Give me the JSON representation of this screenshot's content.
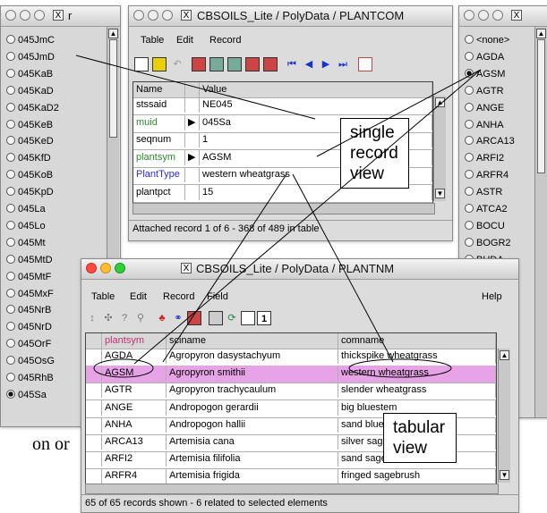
{
  "left_window": {
    "title": "r",
    "items": [
      "045JmC",
      "045JmD",
      "045KaB",
      "045KaD",
      "045KaD2",
      "045KeB",
      "045KeD",
      "045KfD",
      "045KoB",
      "045KpD",
      "045La",
      "045Lo",
      "045Mt",
      "045MtD",
      "045MtF",
      "045MxF",
      "045NrB",
      "045NrD",
      "045OrF",
      "045OsG",
      "045RhB",
      "045Sa"
    ],
    "selected": "045Sa"
  },
  "record_window": {
    "title": "CBSOILS_Lite / PolyData / PLANTCOM",
    "menu": [
      "Table",
      "Edit",
      "Record"
    ],
    "headers": [
      "Name",
      "Value"
    ],
    "rows": [
      {
        "name": "stssaid",
        "value": "NE045",
        "color": "#000000",
        "arrow": ""
      },
      {
        "name": "muid",
        "value": "045Sa",
        "color": "#2c8a2c",
        "arrow": "▶"
      },
      {
        "name": "seqnum",
        "value": "1",
        "color": "#000000",
        "arrow": ""
      },
      {
        "name": "plantsym",
        "value": "AGSM",
        "color": "#2c8a2c",
        "arrow": "▶"
      },
      {
        "name": "PlantType",
        "value": "western wheatgrass",
        "color": "#2b2bd6",
        "arrow": ""
      },
      {
        "name": "plantpct",
        "value": "15",
        "color": "#000000",
        "arrow": ""
      }
    ],
    "status": "Attached record 1 of 6 - 368 of 489 in table"
  },
  "right_window": {
    "title": "",
    "items": [
      "<none>",
      "AGDA",
      "AGSM",
      "AGTR",
      "ANGE",
      "ANHA",
      "ARCA13",
      "ARFI2",
      "ARFR4",
      "ASTR",
      "ATCA2",
      "BOCU",
      "BOGR2",
      "BUDA"
    ],
    "selected": "AGSM"
  },
  "table_window": {
    "title": "CBSOILS_Lite / PolyData / PLANTNM",
    "menu": [
      "Table",
      "Edit",
      "Record",
      "Field"
    ],
    "help": "Help",
    "columns": [
      "plantsym",
      "sciname",
      "comname"
    ],
    "rows": [
      [
        "AGDA",
        "Agropyron dasystachyum",
        "thickspike wheatgrass"
      ],
      [
        "AGSM",
        "Agropyron smithii",
        "western wheatgrass"
      ],
      [
        "AGTR",
        "Agropyron trachycaulum",
        "slender wheatgrass"
      ],
      [
        "ANGE",
        "Andropogon gerardii",
        "big bluestem"
      ],
      [
        "ANHA",
        "Andropogon hallii",
        "sand bluestem"
      ],
      [
        "ARCA13",
        "Artemisia cana",
        "silver sagebrush"
      ],
      [
        "ARFI2",
        "Artemisia filifolia",
        "sand sagebrush"
      ],
      [
        "ARFR4",
        "Artemisia frigida",
        "fringed sagebrush"
      ]
    ],
    "selected_row": 1,
    "status": "65 of 65 records shown - 6 related to selected elements"
  },
  "callouts": {
    "single": "single\nrecord\nview",
    "tabular": "tabular\nview"
  },
  "background_text": "on or",
  "colors": {
    "selected_row": "#e6a3e6",
    "green_field": "#2c8a2c",
    "blue_field": "#2b2bd6",
    "pink_header": "#c03070"
  }
}
